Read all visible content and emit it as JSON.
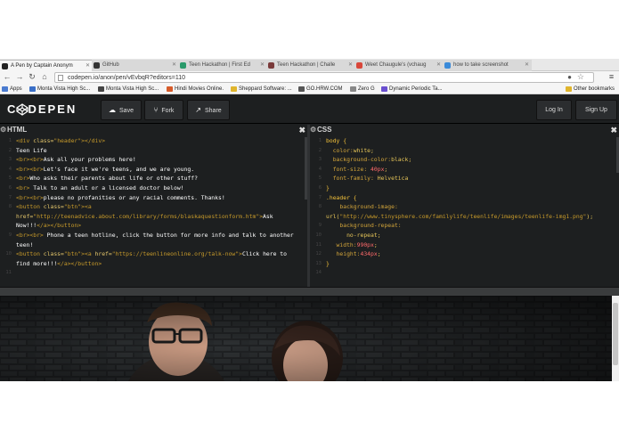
{
  "browser": {
    "tabs": [
      {
        "label": "A Pen by Captain Anonym",
        "active": true
      },
      {
        "label": "GitHub",
        "active": false
      },
      {
        "label": "Teen Hackathon | First Ed",
        "active": false
      },
      {
        "label": "Teen Hackathon | Challe",
        "active": false
      },
      {
        "label": "Weet Chaugule's (vchaug",
        "active": false
      },
      {
        "label": "how to take screenshot",
        "active": false
      }
    ],
    "url": "codepen.io/anon/pen/vEvbqR?editors=110",
    "bookmarks": [
      {
        "label": "Apps",
        "color": "#4a7bd0"
      },
      {
        "label": "Monta Vista High Sc...",
        "color": "#3a6fc7"
      },
      {
        "label": "Monta Vista High Sc...",
        "color": "#444444"
      },
      {
        "label": "Hindi Movies Online.",
        "color": "#d65b2a"
      },
      {
        "label": "Sheppard Software: ...",
        "color": "#e0b52d"
      },
      {
        "label": "GO.HRW.COM",
        "color": "#555555"
      },
      {
        "label": "Zero G",
        "color": "#888888"
      },
      {
        "label": "Dynamic Periodic Ta...",
        "color": "#6a4fd0"
      },
      {
        "label": "Other bookmarks",
        "color": "#e0b52d"
      }
    ]
  },
  "codepen": {
    "logo": "CODEPEN",
    "buttons": {
      "save": "Save",
      "fork": "Fork",
      "share": "Share",
      "login": "Log In",
      "signup": "Sign Up"
    }
  },
  "editors": {
    "html": {
      "title": "HTML",
      "lines": [
        [
          {
            "c": "tag",
            "t": "<div "
          },
          {
            "c": "attr",
            "t": "class="
          },
          {
            "c": "str",
            "t": "\"header\""
          },
          {
            "c": "tag",
            "t": "></div>"
          }
        ],
        [
          {
            "c": "txt",
            "t": "Teen Life"
          }
        ],
        [
          {
            "c": "tag",
            "t": "<br><br>"
          },
          {
            "c": "txt",
            "t": "Ask all your problems here!"
          }
        ],
        [
          {
            "c": "tag",
            "t": "<br><br>"
          },
          {
            "c": "txt",
            "t": "Let's face it we're teens, and we are young."
          }
        ],
        [
          {
            "c": "tag",
            "t": "<br>"
          },
          {
            "c": "txt",
            "t": "Who asks their parents about life or other stuff?"
          }
        ],
        [
          {
            "c": "tag",
            "t": "<br>"
          },
          {
            "c": "txt",
            "t": " Talk to an adult or a licensed doctor below!"
          }
        ],
        [
          {
            "c": "tag",
            "t": "<br><br>"
          },
          {
            "c": "txt",
            "t": "please no profanities or any racial comments. Thanks!"
          }
        ],
        [
          {
            "c": "tag",
            "t": "<button "
          },
          {
            "c": "attr",
            "t": "class="
          },
          {
            "c": "str",
            "t": "\"btn\""
          },
          {
            "c": "tag",
            "t": "><a"
          }
        ],
        [
          {
            "c": "attr",
            "t": "href="
          },
          {
            "c": "str",
            "t": "\"http://teenadvice.about.com/library/forms/blaskaquestionform.htm\""
          },
          {
            "c": "tag",
            "t": ">"
          },
          {
            "c": "txt",
            "t": "Ask"
          }
        ],
        [
          {
            "c": "txt",
            "t": "Now!!!"
          },
          {
            "c": "tag",
            "t": "</a></button>"
          }
        ],
        [
          {
            "c": "tag",
            "t": "<br><br>"
          },
          {
            "c": "txt",
            "t": " Phone a teen hotline, click the button for more info and talk to another"
          }
        ],
        [
          {
            "c": "txt",
            "t": "teen!"
          }
        ],
        [
          {
            "c": "tag",
            "t": "<button "
          },
          {
            "c": "attr",
            "t": "class="
          },
          {
            "c": "str",
            "t": "\"btn\""
          },
          {
            "c": "tag",
            "t": "><a "
          },
          {
            "c": "attr",
            "t": "href="
          },
          {
            "c": "str",
            "t": "\"https://teenlineonline.org/talk-now\""
          },
          {
            "c": "tag",
            "t": ">"
          },
          {
            "c": "txt",
            "t": "Click here to"
          }
        ],
        [
          {
            "c": "txt",
            "t": "find more!!!"
          },
          {
            "c": "tag",
            "t": "</a></button>"
          }
        ],
        [
          {
            "c": "txt",
            "t": ""
          }
        ]
      ],
      "line_numbers": [
        "1",
        "2",
        "3",
        "4",
        "5",
        "6",
        "7",
        "8",
        "",
        "",
        "9",
        "",
        "10",
        "",
        "11"
      ]
    },
    "css": {
      "title": "CSS",
      "lines": [
        [
          {
            "c": "sel",
            "t": "body {"
          }
        ],
        [
          {
            "c": "prop",
            "t": "  color:"
          },
          {
            "c": "val",
            "t": "white;"
          }
        ],
        [
          {
            "c": "prop",
            "t": "  background-color:"
          },
          {
            "c": "val",
            "t": "black;"
          }
        ],
        [
          {
            "c": "prop",
            "t": "  font-size: "
          },
          {
            "c": "num",
            "t": "40px"
          },
          {
            "c": "val",
            "t": ";"
          }
        ],
        [
          {
            "c": "prop",
            "t": "  font-family: "
          },
          {
            "c": "val",
            "t": "Helvetica"
          }
        ],
        [
          {
            "c": "sel",
            "t": "}"
          }
        ],
        [
          {
            "c": "sel",
            "t": ".header {"
          }
        ],
        [
          {
            "c": "prop",
            "t": "    background-image:"
          }
        ],
        [
          {
            "c": "val",
            "t": "url("
          },
          {
            "c": "str",
            "t": "\"http://www.tinysphere.com/familylife/teenlife/images/teenlife-img1.png\""
          },
          {
            "c": "val",
            "t": ");"
          }
        ],
        [
          {
            "c": "prop",
            "t": "    background-repeat:"
          }
        ],
        [
          {
            "c": "val",
            "t": "      no-repeat;"
          }
        ],
        [
          {
            "c": "prop",
            "t": "   width:"
          },
          {
            "c": "num",
            "t": "990px"
          },
          {
            "c": "val",
            "t": ";"
          }
        ],
        [
          {
            "c": "prop",
            "t": "   height:"
          },
          {
            "c": "num",
            "t": "434px"
          },
          {
            "c": "val",
            "t": ";"
          }
        ],
        [
          {
            "c": "sel",
            "t": "}"
          }
        ],
        [
          {
            "c": "txt",
            "t": ""
          }
        ]
      ],
      "line_numbers": [
        "1",
        "2",
        "3",
        "4",
        "5",
        "6",
        "7",
        "8",
        "",
        "9",
        "10",
        "11",
        "12",
        "13",
        "14"
      ]
    }
  },
  "colors": {
    "accent": "#c79a2a",
    "background": "#1d1f20"
  }
}
